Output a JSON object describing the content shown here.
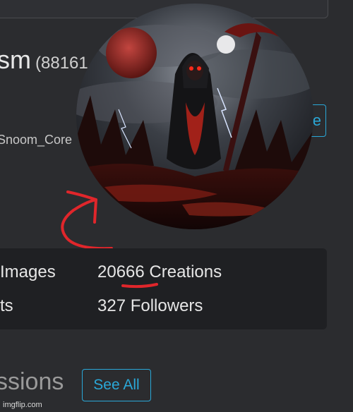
{
  "profile": {
    "username_partial": "sm",
    "count_partial": "(88161",
    "handle_partial": "Snoom_Core",
    "follow_button_partial": "e"
  },
  "stats": {
    "images": "Images",
    "creations": "20666 Creations",
    "likes_partial": "ts",
    "followers": "327 Followers"
  },
  "sections": {
    "title_partial": "ssions",
    "see_all": "See All"
  },
  "watermark": "imgflip.com",
  "colors": {
    "background": "#2b2c2f",
    "card": "#1f2023",
    "accent": "#2aa8d8",
    "annotation": "#e0262b"
  }
}
